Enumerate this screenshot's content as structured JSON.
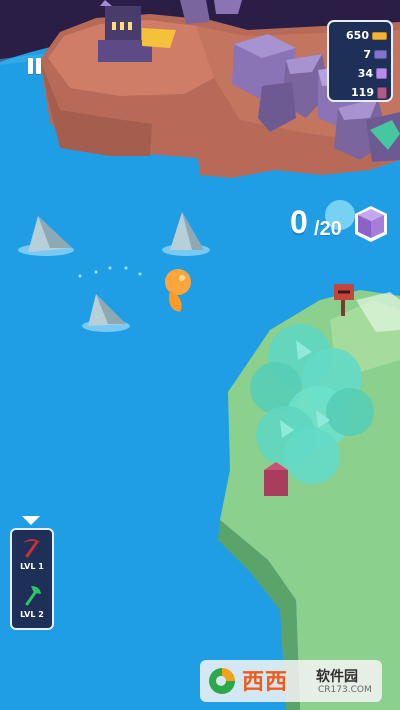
{
  "resources": [
    {
      "count": "650",
      "icon": "gold-bar-icon",
      "color": "#f1b43b"
    },
    {
      "count": "7",
      "icon": "plank-icon",
      "color": "#7f76c7"
    },
    {
      "count": "34",
      "icon": "stone-icon",
      "color": "#b58ee6"
    },
    {
      "count": "119",
      "icon": "crystal-cube-icon",
      "color": "#b05a87"
    }
  ],
  "collection": {
    "current": "0",
    "capacity": "20",
    "icon": "purple-cube-icon"
  },
  "tools": [
    {
      "label": "LVL 1",
      "icon": "pickaxe-icon",
      "color": "#c8332c"
    },
    {
      "label": "LVL 2",
      "icon": "axe-icon",
      "color": "#2fc46a"
    }
  ],
  "watermark": {
    "title": "西西",
    "subtitle": "软件园",
    "url": "CR173.COM"
  },
  "colors": {
    "water": "#1f9ee6",
    "hud_panel": "#1e2f58",
    "cliff": "#b76a57",
    "grass": "#8bd08d",
    "rock": "#8a74b6",
    "tree": "#5fd6c0"
  }
}
